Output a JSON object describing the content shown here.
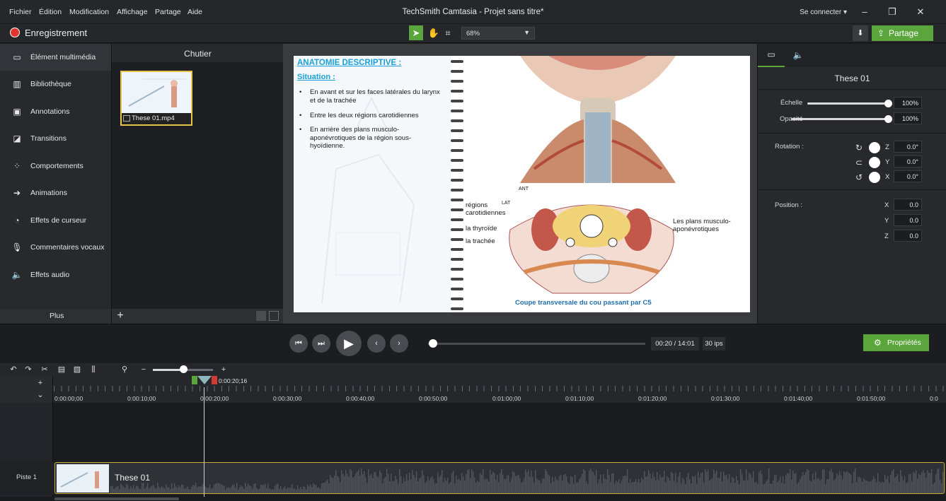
{
  "menu": {
    "items": [
      "Fichier",
      "Édition",
      "Modification",
      "Affichage",
      "Partage",
      "Aide"
    ],
    "title": "TechSmith Camtasia - Projet sans titre*",
    "signin": "Se connecter ▾"
  },
  "toolbar": {
    "record_label": "Enregistrement",
    "zoom_value": "68%",
    "share_label": "Partage"
  },
  "sidebar": {
    "items": [
      {
        "label": "Élément multimédia",
        "icon": "media-icon"
      },
      {
        "label": "Bibliothèque",
        "icon": "library-icon"
      },
      {
        "label": "Annotations",
        "icon": "annotation-icon"
      },
      {
        "label": "Transitions",
        "icon": "transition-icon"
      },
      {
        "label": "Comportements",
        "icon": "behavior-icon"
      },
      {
        "label": "Animations",
        "icon": "animation-icon"
      },
      {
        "label": "Effets de curseur",
        "icon": "cursor-effect-icon"
      },
      {
        "label": "Commentaires vocaux",
        "icon": "microphone-icon"
      },
      {
        "label": "Effets audio",
        "icon": "speaker-icon"
      }
    ],
    "more_label": "Plus"
  },
  "bin": {
    "title": "Chutier",
    "clip_name": "These 01.mp4"
  },
  "slide": {
    "heading": "ANATOMIE DESCRIPTIVE :",
    "subheading": "Situation :",
    "bullets": [
      "En avant et sur les faces latérales du larynx et de la trachée",
      "Entre les deux régions carotidiennes",
      "En arrière des plans musculo-aponévrotiques de la région sous-hyoïdienne."
    ],
    "labels": {
      "ant": "ANT",
      "lat": "LAT",
      "carotid": "régions carotidiennes",
      "thyroid": "la thyroïde",
      "trachea": "la trachée",
      "planes": "Les plans musculo-aponévrotiques"
    },
    "caption": "Coupe transversale du cou passant par C5"
  },
  "properties": {
    "name": "These 01",
    "scale_label": "Échelle",
    "scale_value": "100%",
    "scale_level": 1.0,
    "opacity_label": "Opacité",
    "opacity_value": "100%",
    "opacity_level": 1.0,
    "rotation_label": "Rotation :",
    "rotation": {
      "z": "0.0°",
      "y": "0.0°",
      "x": "0.0°"
    },
    "position_label": "Position :",
    "position": {
      "x": "0.0",
      "y": "0.0",
      "z": "0.0"
    },
    "axis": {
      "x": "X",
      "y": "Y",
      "z": "Z"
    }
  },
  "playback": {
    "timecode": "00:20 / 14:01",
    "fps": "30 ips",
    "properties_label": "Propriétés",
    "progress_fraction": 0.024
  },
  "timeline": {
    "playhead_time": "0:00:20;16",
    "ruler_labels": [
      "0:00:00;00",
      "0:00:10;00",
      "0:00:20;00",
      "0:00:30;00",
      "0:00:40;00",
      "0:00:50;00",
      "0:01:00;00",
      "0:01:10;00",
      "0:01:20;00",
      "0:01:30;00",
      "0:01:40;00",
      "0:01:50;00",
      "0:0"
    ],
    "track_label": "Piste 1",
    "clip_name": "These 01"
  }
}
